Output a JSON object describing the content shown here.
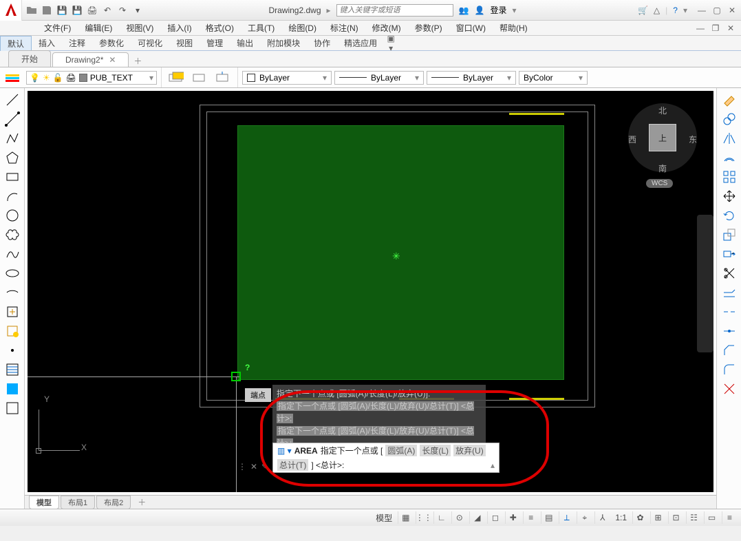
{
  "title": "Drawing2.dwg",
  "search_placeholder": "键入关键字或短语",
  "login_label": "登录",
  "menubar": [
    "文件(F)",
    "编辑(E)",
    "视图(V)",
    "插入(I)",
    "格式(O)",
    "工具(T)",
    "绘图(D)",
    "标注(N)",
    "修改(M)",
    "参数(P)",
    "窗口(W)",
    "帮助(H)"
  ],
  "ribbon_tabs": [
    "默认",
    "插入",
    "注释",
    "参数化",
    "可视化",
    "视图",
    "管理",
    "输出",
    "附加模块",
    "协作",
    "精选应用"
  ],
  "doc_tabs": {
    "home": "开始",
    "active": "Drawing2*"
  },
  "layer": {
    "name": "PUB_TEXT"
  },
  "props": {
    "color": "ByLayer",
    "ltype": "ByLayer",
    "lweight": "ByLayer",
    "plot": "ByColor"
  },
  "nav": {
    "n": "北",
    "s": "南",
    "e": "东",
    "w": "西",
    "top": "上",
    "wcs": "WCS"
  },
  "snap_label": "端点",
  "ucs": {
    "x": "X",
    "y": "Y"
  },
  "cmd": {
    "hist": [
      "指定下一个点或 [圆弧(A)/长度(L)/放弃(U)]:",
      "指定下一个点或 [圆弧(A)/长度(L)/放弃(U)/总计(T)] <总计>:",
      "指定下一个点或 [圆弧(A)/长度(L)/放弃(U)/总计(T)] <总计>:"
    ],
    "name": "AREA",
    "prompt": "指定下一个点或 [",
    "opts": [
      "圆弧(A)",
      "长度(L)",
      "放弃(U)",
      "总计(T)"
    ],
    "tail": "] <总计>:"
  },
  "layout_tabs": {
    "model": "模型",
    "l1": "布局1",
    "l2": "布局2"
  },
  "status": {
    "model": "模型",
    "scale": "1:1"
  }
}
